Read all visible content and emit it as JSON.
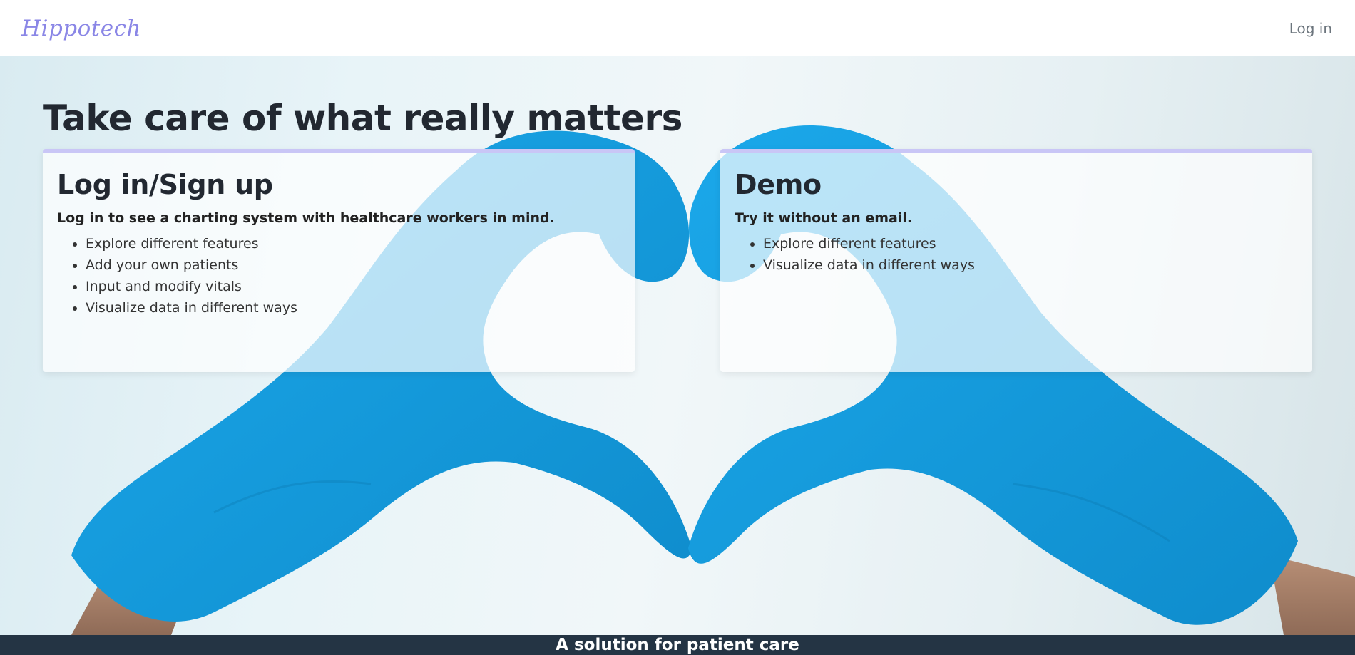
{
  "navbar": {
    "brand": "Hippotech",
    "login_label": "Log in"
  },
  "hero": {
    "headline": "Take care of what really matters"
  },
  "cards": [
    {
      "title": "Log in/Sign up",
      "lead": "Log in to see a charting system with healthcare workers in mind.",
      "items": [
        "Explore different features",
        "Add your own patients",
        "Input and modify vitals",
        "Visualize data in different ways"
      ]
    },
    {
      "title": "Demo",
      "lead": "Try it without an email.",
      "items": [
        "Explore different features",
        "Visualize data in different ways"
      ]
    }
  ],
  "footer": {
    "text": "A solution for patient care"
  },
  "colors": {
    "brand": "#8a86e6",
    "card_accent": "#c9c6f6",
    "glove": "#1aa0e0",
    "footer_bg": "#243444"
  }
}
